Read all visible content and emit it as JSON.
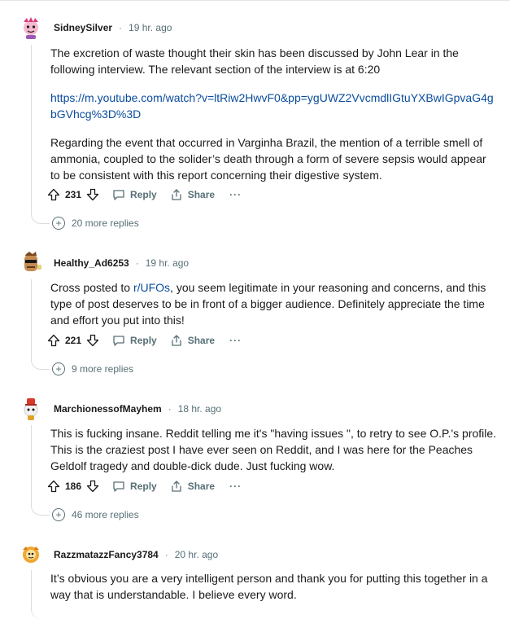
{
  "comments": [
    {
      "username": "SidneySilver",
      "time": "19 hr. ago",
      "paragraphs": [
        "The excretion of waste thought their skin has been discussed by John Lear in the following interview. The relevant section of the interview is at 6:20",
        "https://m.youtube.com/watch?v=ltRiw2HwvF0&pp=ygUWZ2VvcmdlIGtuYXBwIGpvaG4gbGVhcg%3D%3D",
        "Regarding the event that occurred in Varginha Brazil, the mention of a terrible smell of ammonia, coupled to the solider’s death through a form of severe sepsis would appear to be consistent with this report concerning their digestive system."
      ],
      "votes": "231",
      "reply_label": "Reply",
      "share_label": "Share",
      "more_label": "···",
      "more_replies": "20 more replies"
    },
    {
      "username": "Healthy_Ad6253",
      "time": "19 hr. ago",
      "text_before": "Cross posted to ",
      "link": "r/UFOs",
      "text_after": ", you seem legitimate in your reasoning and concerns, and this type of post deserves to be in front of a bigger audience. Definitely appreciate the time and effort you put into this!",
      "votes": "221",
      "reply_label": "Reply",
      "share_label": "Share",
      "more_label": "···",
      "more_replies": "9 more replies"
    },
    {
      "username": "MarchionessofMayhem",
      "time": "18 hr. ago",
      "text": "This is fucking insane. Reddit telling me it's \"having issues \", to retry to see O.P.'s profile. This is the craziest post I have ever seen on Reddit, and I was here for the Peaches Geldolf tragedy and double-dick dude. Just fucking wow.",
      "votes": "186",
      "reply_label": "Reply",
      "share_label": "Share",
      "more_label": "···",
      "more_replies": "46 more replies"
    },
    {
      "username": "RazzmatazzFancy3784",
      "time": "20 hr. ago",
      "text": "It’s obvious you are a very intelligent person and thank you for putting this together in a way that is understandable. I believe every word."
    }
  ],
  "separator": "·"
}
